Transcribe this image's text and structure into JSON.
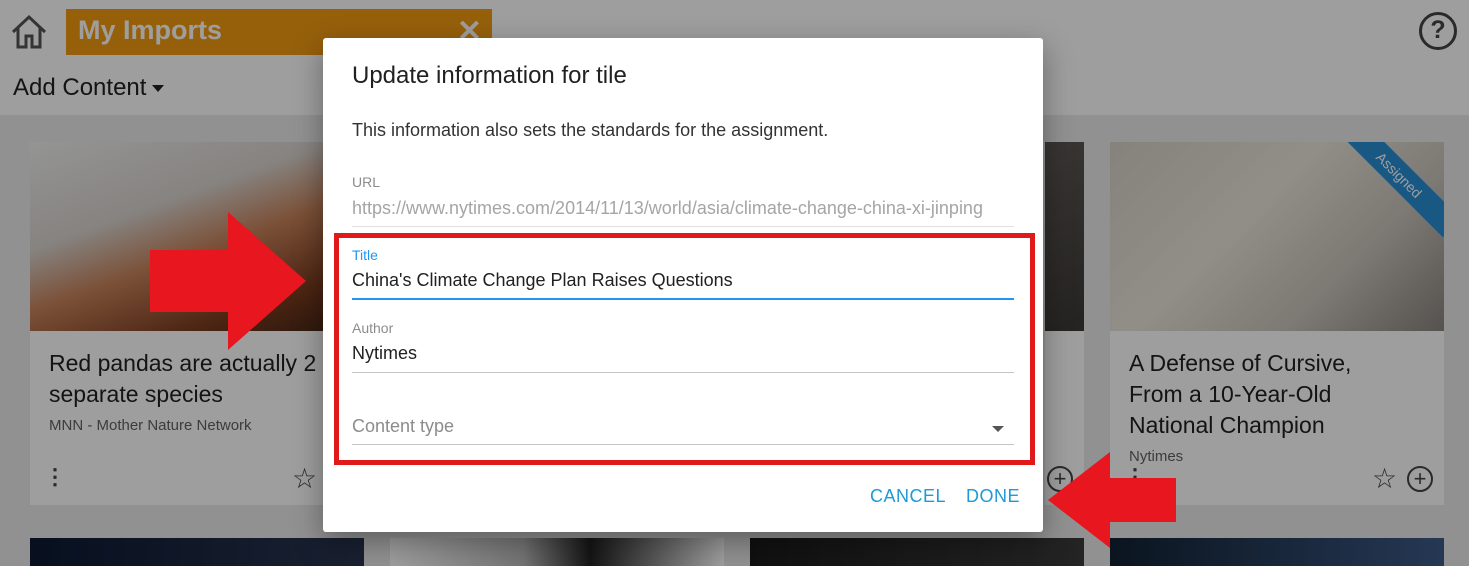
{
  "header": {
    "imports_tab_label": "My Imports",
    "close_glyph": "✕",
    "add_content_label": "Add Content",
    "help_glyph": "?"
  },
  "cards": [
    {
      "title_line1": "Red pandas are actually 2",
      "title_line2": "separate species",
      "source": "MNN - Mother Nature Network"
    },
    {
      "title_line1": "A Defense of Cursive,",
      "title_line2": "From a 10-Year-Old",
      "title_line3": "National Champion",
      "source": "Nytimes",
      "badge": "Assigned"
    }
  ],
  "dialog": {
    "title": "Update information for tile",
    "description": "This information also sets the standards for the assignment.",
    "url_label": "URL",
    "url_value": "https://www.nytimes.com/2014/11/13/world/asia/climate-change-china-xi-jinping",
    "title_label": "Title",
    "title_value": "China's Climate Change Plan Raises Questions",
    "author_label": "Author",
    "author_value": "Nytimes",
    "content_type_placeholder": "Content type",
    "cancel_label": "CANCEL",
    "done_label": "DONE"
  },
  "colors": {
    "accent_blue": "#2196f3",
    "button_blue": "#1e9ad6",
    "imports_orange": "#f39c12",
    "annotation_red": "#e01a1a"
  }
}
